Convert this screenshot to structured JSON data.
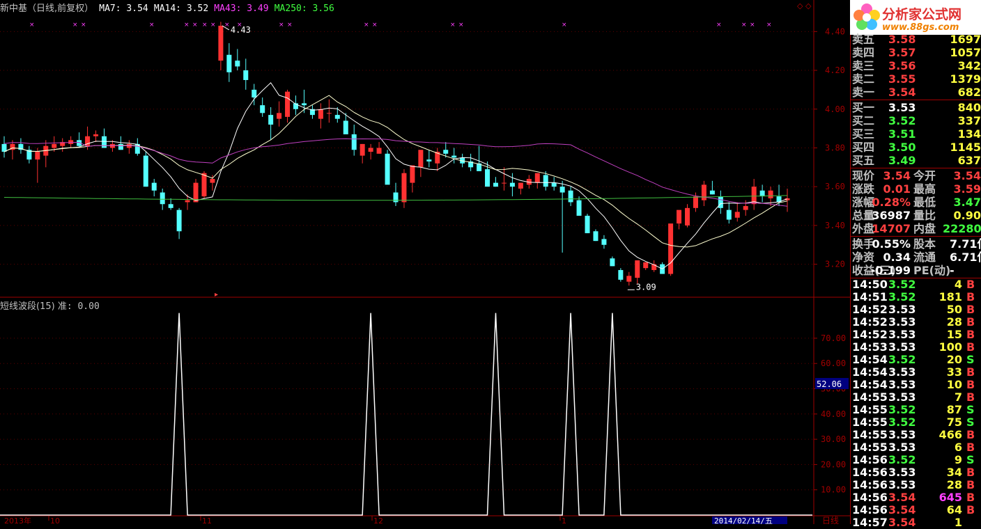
{
  "header": {
    "title": "新中基（日线,前复权）",
    "ma7": "MA7: 3.54",
    "ma14": "MA14: 3.52",
    "ma43": "MA43: 3.49",
    "ma250": "MA250: 3.56",
    "colors": {
      "title": "#c0c0c0",
      "ma7": "#ffffff",
      "ma14": "#ffffff",
      "ma43": "#ff40ff",
      "ma250": "#40ff40"
    }
  },
  "indicator": {
    "name": "短线波段(15)",
    "value_label": "准: 0.00",
    "current_marker": "52.06"
  },
  "price_axis": {
    "ticks": [
      "4.40",
      "4.20",
      "4.00",
      "3.80",
      "3.60",
      "3.40",
      "3.20"
    ]
  },
  "indicator_axis": {
    "ticks": [
      "70.00",
      "60.00",
      "50.00",
      "40.00",
      "30.00",
      "20.00",
      "10.00"
    ]
  },
  "annotations": {
    "high_label": "4.43",
    "low_label": "3.09"
  },
  "time_axis": {
    "labels": [
      "2013年",
      "10",
      "11",
      "12",
      "1"
    ],
    "current_date": "2014/02/14/五",
    "period": "日线"
  },
  "logo": {
    "text": "分析家公式网",
    "url": "www.88gs.com"
  },
  "quote": {
    "sell": [
      {
        "label": "卖五",
        "price": "3.58",
        "vol": "1697"
      },
      {
        "label": "卖四",
        "price": "3.57",
        "vol": "1057"
      },
      {
        "label": "卖三",
        "price": "3.56",
        "vol": "342"
      },
      {
        "label": "卖二",
        "price": "3.55",
        "vol": "1379"
      },
      {
        "label": "卖一",
        "price": "3.54",
        "vol": "682"
      }
    ],
    "buy": [
      {
        "label": "买一",
        "price": "3.53",
        "vol": "840"
      },
      {
        "label": "买二",
        "price": "3.52",
        "vol": "337"
      },
      {
        "label": "买三",
        "price": "3.51",
        "vol": "134"
      },
      {
        "label": "买四",
        "price": "3.50",
        "vol": "1145"
      },
      {
        "label": "买五",
        "price": "3.49",
        "vol": "637"
      }
    ],
    "stats": [
      {
        "l1": "现价",
        "v1": "3.54",
        "l2": "今开",
        "v2": "3.54",
        "c1": "#ff4040",
        "c2": "#ff4040"
      },
      {
        "l1": "涨跌",
        "v1": "0.01",
        "l2": "最高",
        "v2": "3.59",
        "c1": "#ff4040",
        "c2": "#ff4040"
      },
      {
        "l1": "涨幅",
        "v1": "0.28%",
        "l2": "最低",
        "v2": "3.47",
        "c1": "#ff4040",
        "c2": "#40ff40"
      },
      {
        "l1": "总量",
        "v1": "36987",
        "l2": "量比",
        "v2": "0.90",
        "c1": "#ffffff",
        "c2": "#ffff40"
      },
      {
        "l1": "外盘",
        "v1": "14707",
        "l2": "内盘",
        "v2": "22280",
        "c1": "#ff4040",
        "c2": "#40ff40"
      }
    ],
    "fund": [
      {
        "l1": "换手",
        "v1": "0.55%",
        "l2": "股本",
        "v2": "7.71亿"
      },
      {
        "l1": "净资",
        "v1": "0.34",
        "l2": "流通",
        "v2": "6.71亿"
      },
      {
        "l1": "收益(三)",
        "v1": "-0.199",
        "l2": "PE(动)",
        "v2": "-"
      }
    ]
  },
  "ticks": [
    {
      "time": "14:50",
      "price": "3.52",
      "vol": "4",
      "side": "B",
      "pc": "#40ff40",
      "vc": "#ffff40"
    },
    {
      "time": "14:51",
      "price": "3.52",
      "vol": "181",
      "side": "B",
      "pc": "#40ff40",
      "vc": "#ffff40"
    },
    {
      "time": "14:52",
      "price": "3.53",
      "vol": "50",
      "side": "B",
      "pc": "#ffffff",
      "vc": "#ffff40"
    },
    {
      "time": "14:52",
      "price": "3.53",
      "vol": "28",
      "side": "B",
      "pc": "#ffffff",
      "vc": "#ffff40"
    },
    {
      "time": "14:52",
      "price": "3.53",
      "vol": "15",
      "side": "B",
      "pc": "#ffffff",
      "vc": "#ffff40"
    },
    {
      "time": "14:53",
      "price": "3.53",
      "vol": "100",
      "side": "B",
      "pc": "#ffffff",
      "vc": "#ffff40"
    },
    {
      "time": "14:54",
      "price": "3.52",
      "vol": "20",
      "side": "S",
      "pc": "#40ff40",
      "vc": "#ffff40"
    },
    {
      "time": "14:54",
      "price": "3.53",
      "vol": "33",
      "side": "B",
      "pc": "#ffffff",
      "vc": "#ffff40"
    },
    {
      "time": "14:54",
      "price": "3.53",
      "vol": "10",
      "side": "B",
      "pc": "#ffffff",
      "vc": "#ffff40"
    },
    {
      "time": "14:55",
      "price": "3.53",
      "vol": "7",
      "side": "B",
      "pc": "#ffffff",
      "vc": "#ffff40"
    },
    {
      "time": "14:55",
      "price": "3.52",
      "vol": "87",
      "side": "S",
      "pc": "#40ff40",
      "vc": "#ffff40"
    },
    {
      "time": "14:55",
      "price": "3.52",
      "vol": "75",
      "side": "S",
      "pc": "#40ff40",
      "vc": "#ffff40"
    },
    {
      "time": "14:55",
      "price": "3.53",
      "vol": "466",
      "side": "B",
      "pc": "#ffffff",
      "vc": "#ffff40"
    },
    {
      "time": "14:55",
      "price": "3.53",
      "vol": "6",
      "side": "B",
      "pc": "#ffffff",
      "vc": "#ffff40"
    },
    {
      "time": "14:56",
      "price": "3.52",
      "vol": "9",
      "side": "S",
      "pc": "#40ff40",
      "vc": "#ffff40"
    },
    {
      "time": "14:56",
      "price": "3.53",
      "vol": "34",
      "side": "B",
      "pc": "#ffffff",
      "vc": "#ffff40"
    },
    {
      "time": "14:56",
      "price": "3.53",
      "vol": "28",
      "side": "B",
      "pc": "#ffffff",
      "vc": "#ffff40"
    },
    {
      "time": "14:56",
      "price": "3.54",
      "vol": "645",
      "side": "B",
      "pc": "#ff4040",
      "vc": "#ff40ff"
    },
    {
      "time": "14:56",
      "price": "3.54",
      "vol": "64",
      "side": "B",
      "pc": "#ff4040",
      "vc": "#ffff40"
    },
    {
      "time": "14:57",
      "price": "3.54",
      "vol": "1",
      "side": "",
      "pc": "#ff4040",
      "vc": "#ffff40"
    }
  ],
  "candles": [
    [
      3.82,
      3.86,
      3.75,
      3.78
    ],
    [
      3.79,
      3.84,
      3.74,
      3.82
    ],
    [
      3.82,
      3.85,
      3.77,
      3.79
    ],
    [
      3.79,
      3.81,
      3.72,
      3.74
    ],
    [
      3.74,
      3.8,
      3.62,
      3.78
    ],
    [
      3.76,
      3.84,
      3.7,
      3.81
    ],
    [
      3.8,
      3.86,
      3.78,
      3.82
    ],
    [
      3.81,
      3.85,
      3.78,
      3.83
    ],
    [
      3.82,
      3.86,
      3.8,
      3.84
    ],
    [
      3.84,
      3.88,
      3.8,
      3.81
    ],
    [
      3.81,
      3.91,
      3.79,
      3.86
    ],
    [
      3.86,
      3.89,
      3.83,
      3.87
    ],
    [
      3.86,
      3.9,
      3.8,
      3.8
    ],
    [
      3.8,
      3.84,
      3.78,
      3.82
    ],
    [
      3.82,
      3.86,
      3.79,
      3.79
    ],
    [
      3.8,
      3.84,
      3.77,
      3.82
    ],
    [
      3.82,
      3.85,
      3.76,
      3.77
    ],
    [
      3.76,
      3.78,
      3.6,
      3.6
    ],
    [
      3.62,
      3.64,
      3.55,
      3.58
    ],
    [
      3.57,
      3.59,
      3.48,
      3.51
    ],
    [
      3.51,
      3.54,
      3.48,
      3.49
    ],
    [
      3.48,
      3.49,
      3.33,
      3.37
    ],
    [
      3.52,
      3.56,
      3.48,
      3.53
    ],
    [
      3.52,
      3.64,
      3.55,
      3.62
    ],
    [
      3.55,
      3.68,
      3.54,
      3.67
    ],
    [
      3.62,
      3.66,
      3.58,
      3.64
    ],
    [
      4.25,
      4.45,
      4.2,
      4.43
    ],
    [
      4.28,
      4.34,
      4.14,
      4.19
    ],
    [
      4.25,
      4.31,
      4.2,
      4.22
    ],
    [
      4.2,
      4.26,
      4.1,
      4.15
    ],
    [
      4.1,
      4.13,
      4.02,
      4.06
    ],
    [
      4.02,
      4.06,
      3.96,
      3.98
    ],
    [
      3.97,
      4.01,
      3.84,
      3.92
    ],
    [
      3.95,
      4.04,
      3.91,
      3.98
    ],
    [
      3.96,
      4.1,
      3.93,
      4.09
    ],
    [
      4.03,
      4.07,
      3.97,
      4.0
    ],
    [
      4.03,
      4.1,
      3.98,
      4.02
    ],
    [
      4.0,
      4.02,
      3.95,
      3.97
    ],
    [
      3.95,
      4.03,
      3.9,
      4.0
    ],
    [
      3.98,
      4.05,
      3.93,
      3.98
    ],
    [
      3.97,
      4.01,
      3.93,
      3.95
    ],
    [
      3.94,
      3.98,
      3.9,
      3.87
    ],
    [
      3.87,
      3.92,
      3.76,
      3.79
    ],
    [
      3.76,
      3.82,
      3.72,
      3.82
    ],
    [
      3.78,
      3.82,
      3.74,
      3.8
    ],
    [
      3.77,
      3.83,
      3.77,
      3.8
    ],
    [
      3.77,
      3.79,
      3.7,
      3.61
    ],
    [
      3.57,
      3.62,
      3.5,
      3.52
    ],
    [
      3.52,
      3.69,
      3.49,
      3.67
    ],
    [
      3.62,
      3.7,
      3.57,
      3.71
    ],
    [
      3.7,
      3.78,
      3.65,
      3.79
    ],
    [
      3.74,
      3.79,
      3.7,
      3.73
    ],
    [
      3.72,
      3.8,
      3.68,
      3.78
    ],
    [
      3.79,
      3.83,
      3.75,
      3.77
    ],
    [
      3.76,
      3.8,
      3.72,
      3.75
    ],
    [
      3.75,
      3.77,
      3.7,
      3.72
    ],
    [
      3.73,
      3.77,
      3.68,
      3.7
    ],
    [
      3.72,
      3.81,
      3.69,
      3.68
    ],
    [
      3.69,
      3.73,
      3.65,
      3.6
    ],
    [
      3.62,
      3.65,
      3.6,
      3.6
    ],
    [
      3.62,
      3.7,
      3.58,
      3.62
    ],
    [
      3.62,
      3.67,
      3.55,
      3.6
    ],
    [
      3.59,
      3.62,
      3.56,
      3.62
    ],
    [
      3.61,
      3.66,
      3.59,
      3.64
    ],
    [
      3.62,
      3.67,
      3.59,
      3.67
    ],
    [
      3.66,
      3.68,
      3.58,
      3.6
    ],
    [
      3.62,
      3.65,
      3.58,
      3.6
    ],
    [
      3.6,
      3.63,
      3.26,
      3.57
    ],
    [
      3.58,
      3.6,
      3.5,
      3.52
    ],
    [
      3.53,
      3.55,
      3.46,
      3.45
    ],
    [
      3.45,
      3.46,
      3.36,
      3.36
    ],
    [
      3.37,
      3.38,
      3.32,
      3.32
    ],
    [
      3.33,
      3.35,
      3.28,
      3.3
    ],
    [
      3.23,
      3.24,
      3.19,
      3.19
    ],
    [
      3.17,
      3.18,
      3.11,
      3.12
    ],
    [
      3.11,
      3.16,
      3.09,
      3.14
    ],
    [
      3.13,
      3.22,
      3.1,
      3.22
    ],
    [
      3.18,
      3.21,
      3.17,
      3.21
    ],
    [
      3.17,
      3.22,
      3.16,
      3.2
    ],
    [
      3.2,
      3.21,
      3.15,
      3.15
    ],
    [
      3.15,
      3.38,
      3.14,
      3.41
    ],
    [
      3.41,
      3.47,
      3.38,
      3.48
    ],
    [
      3.4,
      3.51,
      3.39,
      3.49
    ],
    [
      3.49,
      3.57,
      3.47,
      3.55
    ],
    [
      3.53,
      3.63,
      3.5,
      3.61
    ],
    [
      3.58,
      3.63,
      3.56,
      3.56
    ],
    [
      3.55,
      3.58,
      3.46,
      3.49
    ],
    [
      3.48,
      3.52,
      3.41,
      3.43
    ],
    [
      3.44,
      3.52,
      3.42,
      3.47
    ],
    [
      3.48,
      3.53,
      3.45,
      3.5
    ],
    [
      3.51,
      3.64,
      3.48,
      3.6
    ],
    [
      3.58,
      3.61,
      3.52,
      3.55
    ],
    [
      3.54,
      3.6,
      3.5,
      3.58
    ],
    [
      3.55,
      3.61,
      3.5,
      3.52
    ],
    [
      3.53,
      3.59,
      3.47,
      3.54
    ]
  ],
  "indicator_spikes": [
    21,
    44,
    59,
    68,
    73
  ]
}
